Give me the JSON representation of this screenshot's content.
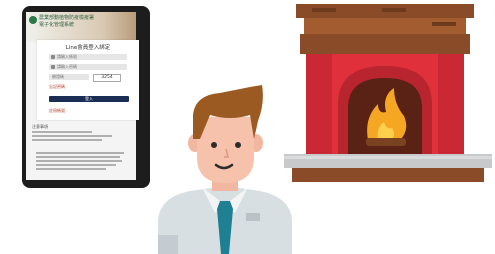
{
  "tablet": {
    "banner_line1": "農業部動植物防疫檢疫署",
    "banner_line2": "電子化管理系統",
    "card_title": "Line會員登入綁定",
    "account_placeholder": "請輸入帳號",
    "password_placeholder": "請輸入密碼",
    "captcha_placeholder": "驗證碼",
    "captcha_code": "3254",
    "forgot_password": "忘記密碼",
    "login_button": "登入",
    "register_link": "註冊帳號",
    "notes_title": "注意事項"
  },
  "colors": {
    "tablet_frame": "#1d1d1d",
    "login_button": "#1a2e55",
    "fireplace_brick": "#8a4b28",
    "fireplace_red": "#e0303c",
    "fire_yellow": "#f5a623",
    "shirt": "#d8dfe3",
    "tie": "#1f7f93",
    "hair": "#9b5a22"
  },
  "icons": [
    "user-icon",
    "lock-icon",
    "person-illustration",
    "fireplace-illustration"
  ]
}
